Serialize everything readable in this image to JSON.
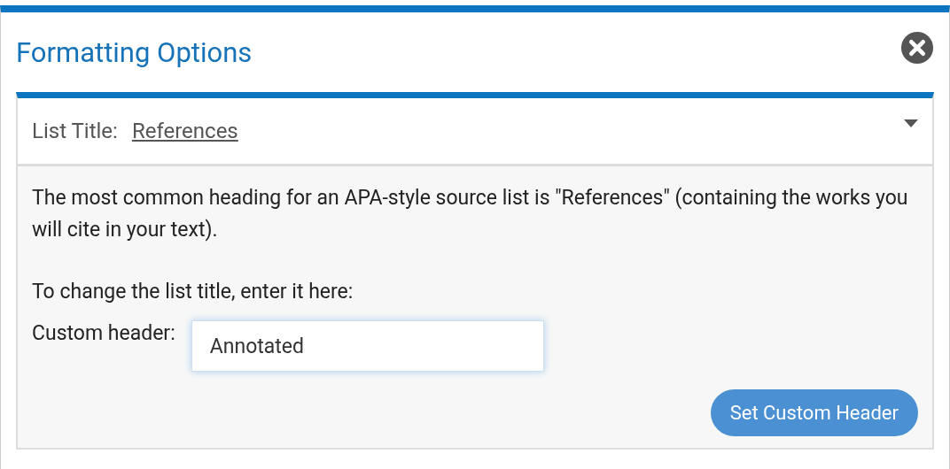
{
  "dialog": {
    "title": "Formatting Options"
  },
  "section": {
    "label": "List Title:",
    "value": "References",
    "expanded": true,
    "description": "The most common heading for an APA-style source list is \"References\" (containing the works you will cite in your text).",
    "prompt": "To change the list title, enter it here:",
    "field": {
      "label": "Custom header:",
      "value": "Annotated"
    },
    "button": "Set Custom Header"
  }
}
